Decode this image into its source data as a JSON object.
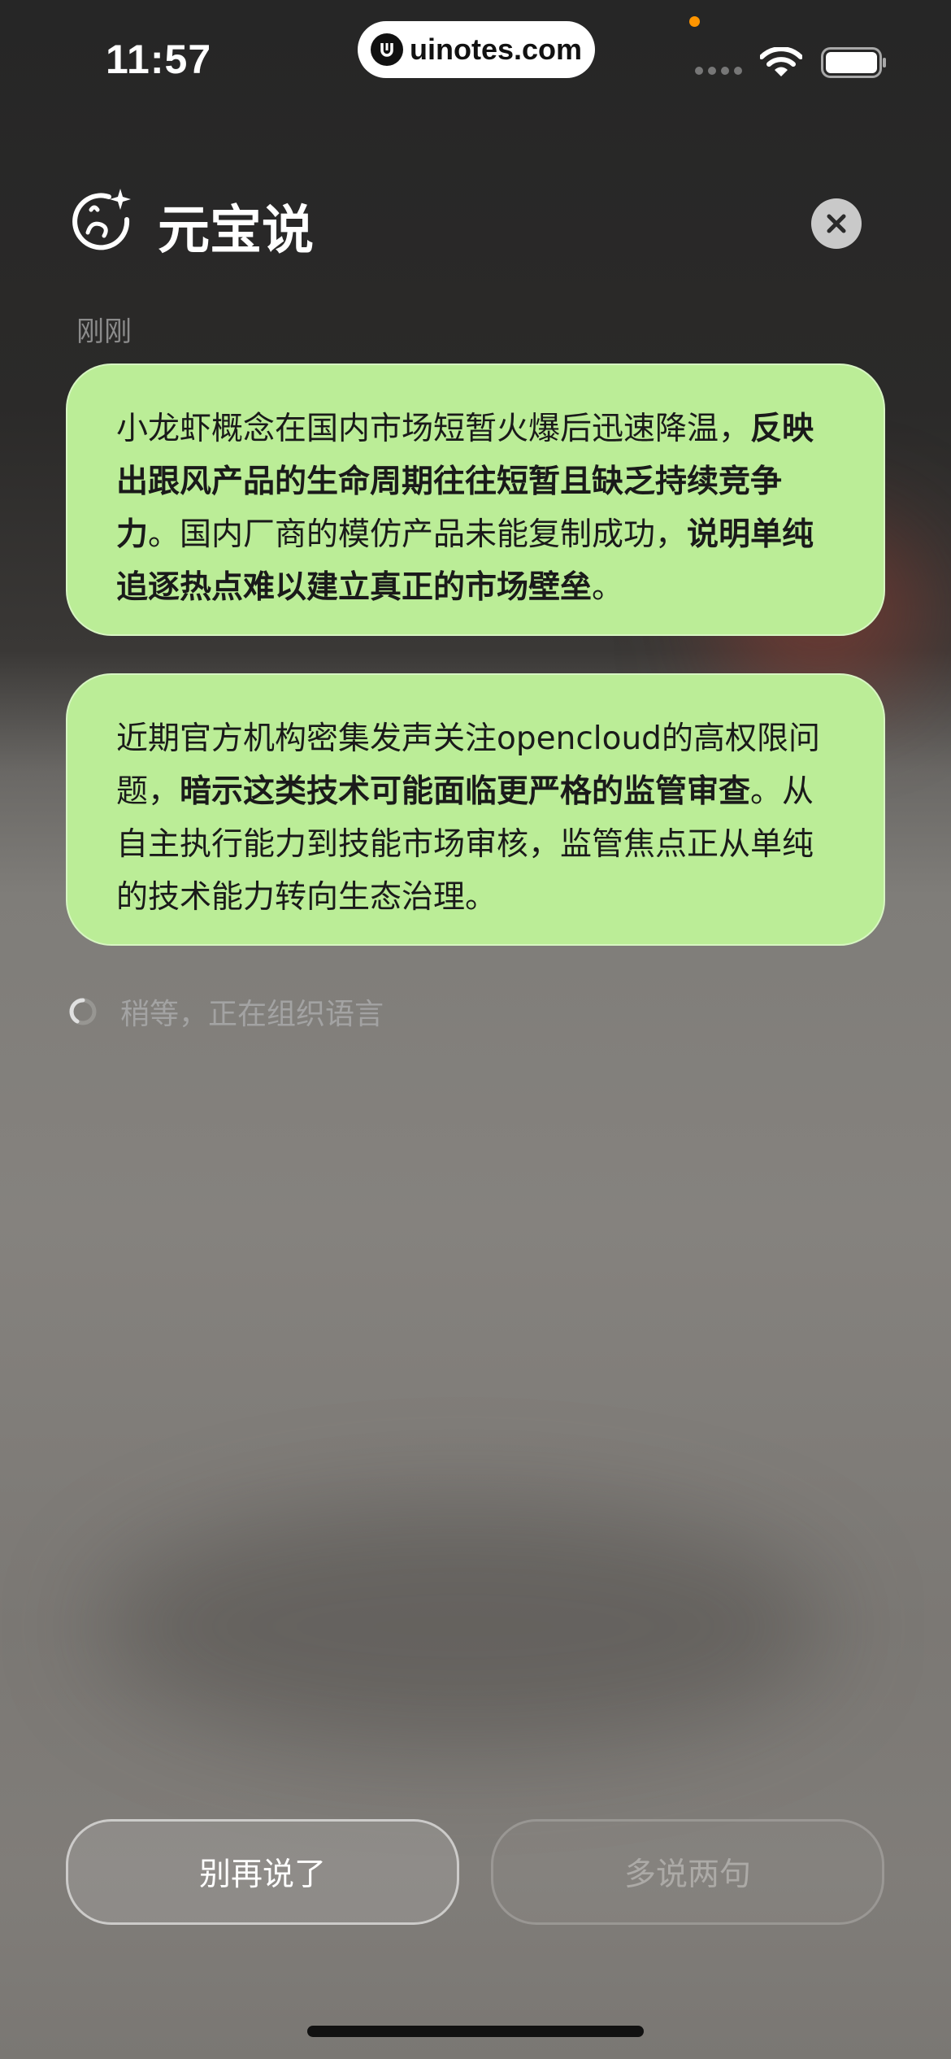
{
  "status_bar": {
    "time": "11:57",
    "watermark": "uinotes.com"
  },
  "header": {
    "title": "元宝说",
    "logo_icon": "yuanbao-sparkle-face-icon",
    "close_icon": "close-icon"
  },
  "timestamp": "刚刚",
  "messages": [
    {
      "segments": [
        {
          "text": "小龙虾概念在国内市场短暂火爆后迅速降温，",
          "bold": false
        },
        {
          "text": "反映出跟风产品的生命周期往往短暂且缺乏持续竞争力",
          "bold": true
        },
        {
          "text": "。国内厂商的模仿产品未能复制成功，",
          "bold": false
        },
        {
          "text": "说明单纯追逐热点难以建立真正的市场壁垒",
          "bold": true
        },
        {
          "text": "。",
          "bold": false
        }
      ]
    },
    {
      "segments": [
        {
          "text": "近期官方机构密集发声关注opencloud的高权限问题，",
          "bold": false
        },
        {
          "text": "暗示这类技术可能面临更严格的监管审查",
          "bold": true
        },
        {
          "text": "。从自主执行能力到技能市场审核，监管焦点正从单纯的技术能力转向生态治理。",
          "bold": false
        }
      ]
    }
  ],
  "loading_text": "稍等，正在组织语言",
  "buttons": {
    "stop_label": "别再说了",
    "more_label": "多说两句"
  },
  "colors": {
    "bubble": "#bbed97",
    "bubble_text": "#1a1a1a"
  }
}
